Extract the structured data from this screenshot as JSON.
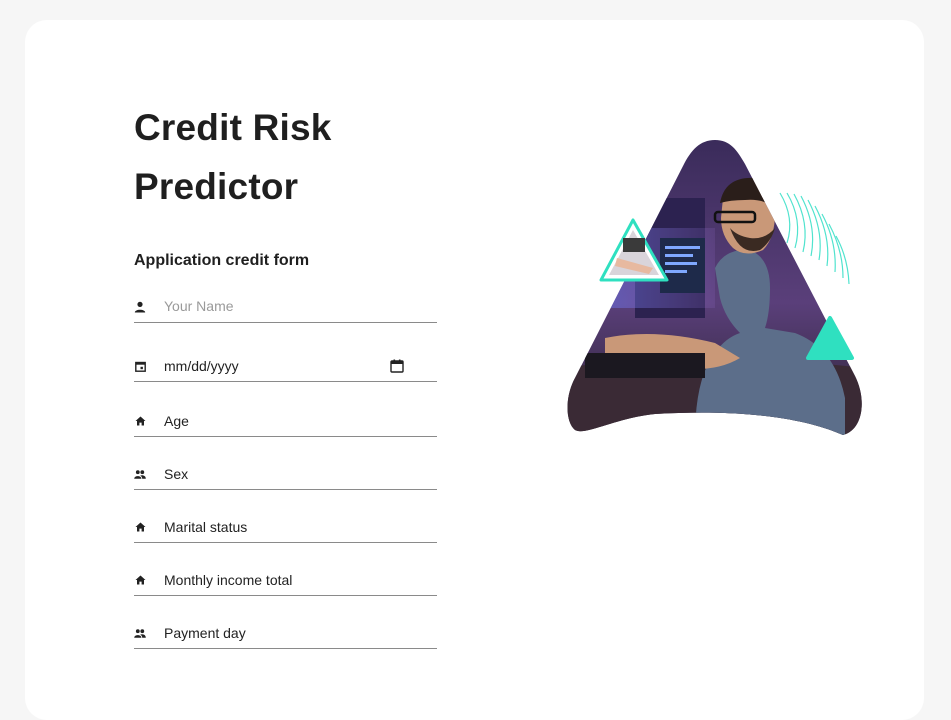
{
  "page": {
    "title_line1": "Credit Risk",
    "title_line2": "Predictor",
    "subtitle": "Application credit form"
  },
  "form": {
    "fields": [
      {
        "label": "Your Name",
        "icon": "person-icon",
        "type": "text-placeholder"
      },
      {
        "label": "mm/dd/yyyy",
        "icon": "calendar-icon",
        "type": "date"
      },
      {
        "label": "Age",
        "icon": "home-icon",
        "type": "select"
      },
      {
        "label": "Sex",
        "icon": "group-icon",
        "type": "select"
      },
      {
        "label": "Marital status",
        "icon": "home-icon",
        "type": "select"
      },
      {
        "label": "Monthly income total",
        "icon": "home-icon",
        "type": "select"
      },
      {
        "label": "Payment day",
        "icon": "group-icon",
        "type": "select"
      }
    ]
  },
  "colors": {
    "background": "#f6f6f6",
    "card": "#ffffff",
    "text": "#1f1f1f",
    "accent": "#2fe0c0",
    "underline": "#8a8a8a"
  }
}
